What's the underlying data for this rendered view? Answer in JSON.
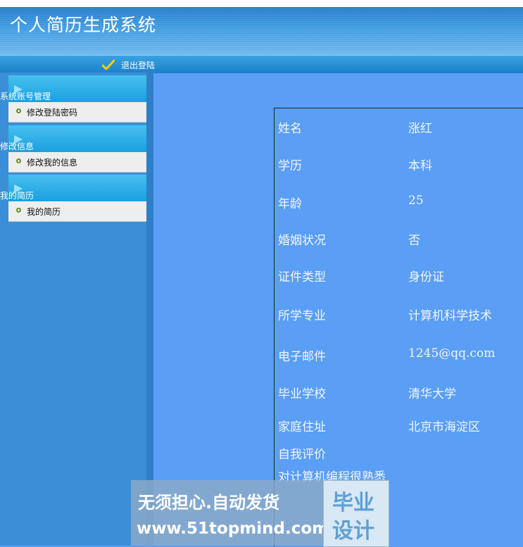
{
  "header": {
    "title": "个人简历生成系统",
    "logout_label": "退出登陆"
  },
  "sidebar": {
    "groups": [
      {
        "title": "系统账号管理",
        "items": [
          {
            "label": "修改登陆密码"
          }
        ]
      },
      {
        "title": "修改信息",
        "items": [
          {
            "label": "修改我的信息"
          }
        ]
      },
      {
        "title": "我的简历",
        "items": [
          {
            "label": "我的简历"
          }
        ]
      }
    ]
  },
  "profile": {
    "rows": [
      {
        "label": "姓名",
        "value": "涨红"
      },
      {
        "label": "学历",
        "value": "本科"
      },
      {
        "label": "年龄",
        "value": "25"
      },
      {
        "label": "婚姻状况",
        "value": "否"
      },
      {
        "label": "证件类型",
        "value": "身份证"
      },
      {
        "label": "所学专业",
        "value": "计算机科学技术"
      },
      {
        "label": "电子邮件",
        "value": "1245@qq.com"
      },
      {
        "label": "毕业学校",
        "value": "清华大学"
      },
      {
        "label": "家庭住址",
        "value": "北京市海淀区"
      }
    ],
    "self_eval_label": "自我评价",
    "self_eval_text": "对计算机编程很熟悉"
  },
  "watermark": {
    "line1": "无须担心.自动发货",
    "line2": "www.51topmind.com",
    "badge_1": "毕业",
    "badge_2": "设计"
  },
  "colors": {
    "content_bg": "#5a9ef5",
    "sidebar_bg": "#3b8fd6",
    "header_bg": "#1a74c4"
  }
}
